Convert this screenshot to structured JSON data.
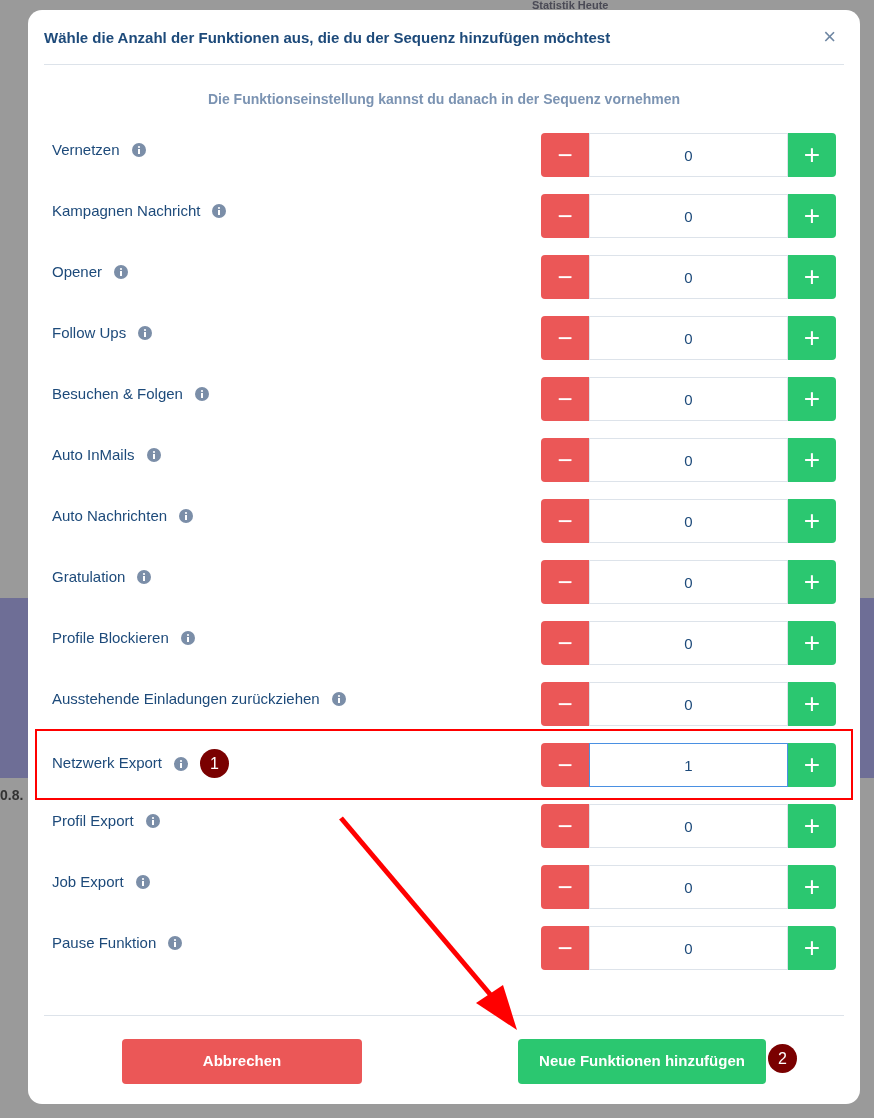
{
  "background": {
    "title": "Statistik Heute",
    "fragment": "0.8."
  },
  "dialog": {
    "title": "Wähle die Anzahl der Funktionen aus, die du der Sequenz hinzufügen möchtest",
    "close": "×",
    "subtitle": "Die Funktionseinstellung kannst du danach in der Sequenz vornehmen"
  },
  "rows": [
    {
      "label": "Vernetzen",
      "value": "0",
      "minus": "−",
      "plus": "+",
      "highlighted": false,
      "focused": false
    },
    {
      "label": "Kampagnen Nachricht",
      "value": "0",
      "minus": "−",
      "plus": "+",
      "highlighted": false,
      "focused": false
    },
    {
      "label": "Opener",
      "value": "0",
      "minus": "−",
      "plus": "+",
      "highlighted": false,
      "focused": false
    },
    {
      "label": "Follow Ups",
      "value": "0",
      "minus": "−",
      "plus": "+",
      "highlighted": false,
      "focused": false
    },
    {
      "label": "Besuchen & Folgen",
      "value": "0",
      "minus": "−",
      "plus": "+",
      "highlighted": false,
      "focused": false
    },
    {
      "label": "Auto InMails",
      "value": "0",
      "minus": "−",
      "plus": "+",
      "highlighted": false,
      "focused": false
    },
    {
      "label": "Auto Nachrichten",
      "value": "0",
      "minus": "−",
      "plus": "+",
      "highlighted": false,
      "focused": false
    },
    {
      "label": "Gratulation",
      "value": "0",
      "minus": "−",
      "plus": "+",
      "highlighted": false,
      "focused": false
    },
    {
      "label": "Profile Blockieren",
      "value": "0",
      "minus": "−",
      "plus": "+",
      "highlighted": false,
      "focused": false
    },
    {
      "label": "Ausstehende Einladungen zurückziehen",
      "value": "0",
      "minus": "−",
      "plus": "+",
      "highlighted": false,
      "focused": false
    },
    {
      "label": "Netzwerk Export",
      "value": "1",
      "minus": "−",
      "plus": "+",
      "highlighted": true,
      "focused": true,
      "step": "1"
    },
    {
      "label": "Profil Export",
      "value": "0",
      "minus": "−",
      "plus": "+",
      "highlighted": false,
      "focused": false
    },
    {
      "label": "Job Export",
      "value": "0",
      "minus": "−",
      "plus": "+",
      "highlighted": false,
      "focused": false
    },
    {
      "label": "Pause Funktion",
      "value": "0",
      "minus": "−",
      "plus": "+",
      "highlighted": false,
      "focused": false
    }
  ],
  "buttons": {
    "cancel": "Abbrechen",
    "confirm": "Neue Funktionen hinzufügen",
    "confirm_step": "2"
  }
}
